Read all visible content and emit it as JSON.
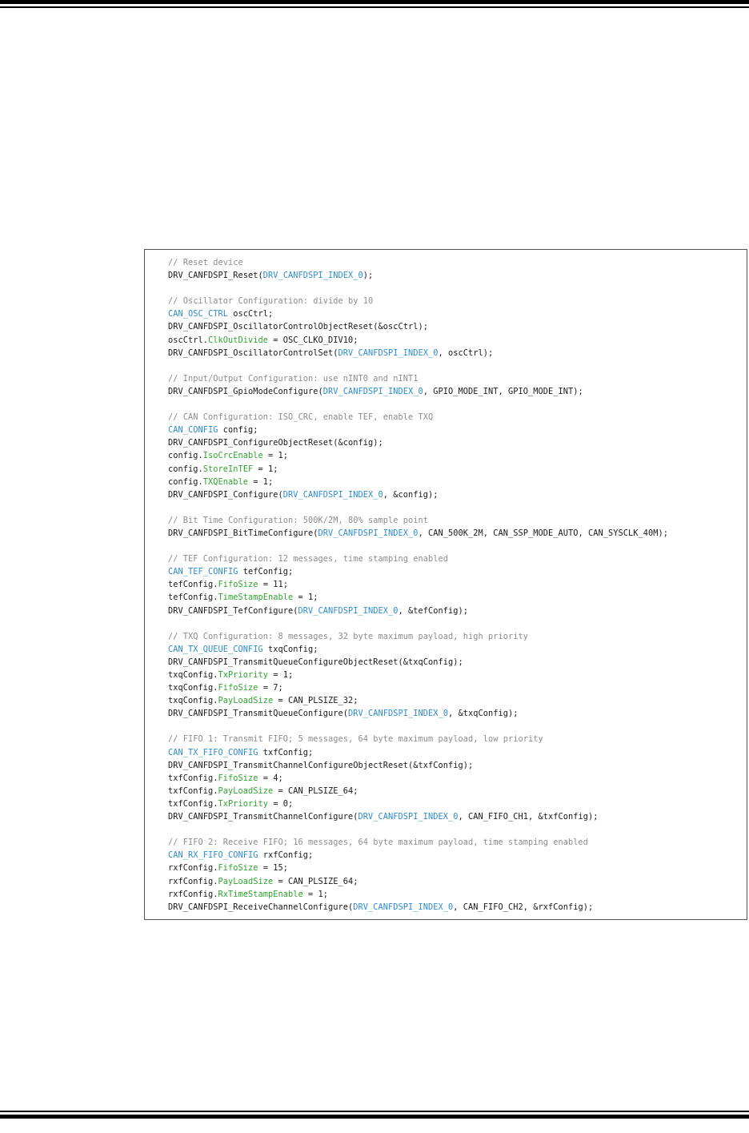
{
  "colors": {
    "plain": "#1a1a1a",
    "comment": "#8c8c8c",
    "type": "#2e8ccf",
    "field": "#2fa52f"
  },
  "code_lines": [
    [
      [
        "c",
        "// Reset device"
      ]
    ],
    [
      [
        "p",
        "DRV_CANFDSPI_Reset("
      ],
      [
        "t",
        "DRV_CANFDSPI_INDEX_0"
      ],
      [
        "p",
        ");"
      ]
    ],
    [],
    [
      [
        "c",
        "// Oscillator Configuration: divide by 10"
      ]
    ],
    [
      [
        "t",
        "CAN_OSC_CTRL"
      ],
      [
        "p",
        " oscCtrl;"
      ]
    ],
    [
      [
        "p",
        "DRV_CANFDSPI_OscillatorControlObjectReset(&oscCtrl);"
      ]
    ],
    [
      [
        "p",
        "oscCtrl."
      ],
      [
        "f",
        "ClkOutDivide"
      ],
      [
        "p",
        " = OSC_CLKO_DIV10;"
      ]
    ],
    [
      [
        "p",
        "DRV_CANFDSPI_OscillatorControlSet("
      ],
      [
        "t",
        "DRV_CANFDSPI_INDEX_0"
      ],
      [
        "p",
        ", oscCtrl);"
      ]
    ],
    [],
    [
      [
        "c",
        "// Input/Output Configuration: use nINT0 and nINT1"
      ]
    ],
    [
      [
        "p",
        "DRV_CANFDSPI_GpioModeConfigure("
      ],
      [
        "t",
        "DRV_CANFDSPI_INDEX_0"
      ],
      [
        "p",
        ", GPIO_MODE_INT, GPIO_MODE_INT);"
      ]
    ],
    [],
    [
      [
        "c",
        "// CAN Configuration: ISO_CRC, enable TEF, enable TXQ"
      ]
    ],
    [
      [
        "t",
        "CAN_CONFIG"
      ],
      [
        "p",
        " config;"
      ]
    ],
    [
      [
        "p",
        "DRV_CANFDSPI_ConfigureObjectReset(&config);"
      ]
    ],
    [
      [
        "p",
        "config."
      ],
      [
        "f",
        "IsoCrcEnable"
      ],
      [
        "p",
        " = 1;"
      ]
    ],
    [
      [
        "p",
        "config."
      ],
      [
        "f",
        "StoreInTEF"
      ],
      [
        "p",
        " = 1;"
      ]
    ],
    [
      [
        "p",
        "config."
      ],
      [
        "f",
        "TXQEnable"
      ],
      [
        "p",
        " = 1;"
      ]
    ],
    [
      [
        "p",
        "DRV_CANFDSPI_Configure("
      ],
      [
        "t",
        "DRV_CANFDSPI_INDEX_0"
      ],
      [
        "p",
        ", &config);"
      ]
    ],
    [],
    [
      [
        "c",
        "// Bit Time Configuration: 500K/2M, 80% sample point"
      ]
    ],
    [
      [
        "p",
        "DRV_CANFDSPI_BitTimeConfigure("
      ],
      [
        "t",
        "DRV_CANFDSPI_INDEX_0"
      ],
      [
        "p",
        ", CAN_500K_2M, CAN_SSP_MODE_AUTO, CAN_SYSCLK_40M);"
      ]
    ],
    [],
    [
      [
        "c",
        "// TEF Configuration: 12 messages, time stamping enabled"
      ]
    ],
    [
      [
        "t",
        "CAN_TEF_CONFIG"
      ],
      [
        "p",
        " tefConfig;"
      ]
    ],
    [
      [
        "p",
        "tefConfig."
      ],
      [
        "f",
        "FifoSize"
      ],
      [
        "p",
        " = 11;"
      ]
    ],
    [
      [
        "p",
        "tefConfig."
      ],
      [
        "f",
        "TimeStampEnable"
      ],
      [
        "p",
        " = 1;"
      ]
    ],
    [
      [
        "p",
        "DRV_CANFDSPI_TefConfigure("
      ],
      [
        "t",
        "DRV_CANFDSPI_INDEX_0"
      ],
      [
        "p",
        ", &tefConfig);"
      ]
    ],
    [],
    [
      [
        "c",
        "// TXQ Configuration: 8 messages, 32 byte maximum payload, high priority"
      ]
    ],
    [
      [
        "t",
        "CAN_TX_QUEUE_CONFIG"
      ],
      [
        "p",
        " txqConfig;"
      ]
    ],
    [
      [
        "p",
        "DRV_CANFDSPI_TransmitQueueConfigureObjectReset(&txqConfig);"
      ]
    ],
    [
      [
        "p",
        "txqConfig."
      ],
      [
        "f",
        "TxPriority"
      ],
      [
        "p",
        " = 1;"
      ]
    ],
    [
      [
        "p",
        "txqConfig."
      ],
      [
        "f",
        "FifoSize"
      ],
      [
        "p",
        " = 7;"
      ]
    ],
    [
      [
        "p",
        "txqConfig."
      ],
      [
        "f",
        "PayLoadSize"
      ],
      [
        "p",
        " = CAN_PLSIZE_32;"
      ]
    ],
    [
      [
        "p",
        "DRV_CANFDSPI_TransmitQueueConfigure("
      ],
      [
        "t",
        "DRV_CANFDSPI_INDEX_0"
      ],
      [
        "p",
        ", &txqConfig);"
      ]
    ],
    [],
    [
      [
        "c",
        "// FIFO 1: Transmit FIFO; 5 messages, 64 byte maximum payload, low priority"
      ]
    ],
    [
      [
        "t",
        "CAN_TX_FIFO_CONFIG"
      ],
      [
        "p",
        " txfConfig;"
      ]
    ],
    [
      [
        "p",
        "DRV_CANFDSPI_TransmitChannelConfigureObjectReset(&txfConfig);"
      ]
    ],
    [
      [
        "p",
        "txfConfig."
      ],
      [
        "f",
        "FifoSize"
      ],
      [
        "p",
        " = 4;"
      ]
    ],
    [
      [
        "p",
        "txfConfig."
      ],
      [
        "f",
        "PayLoadSize"
      ],
      [
        "p",
        " = CAN_PLSIZE_64;"
      ]
    ],
    [
      [
        "p",
        "txfConfig."
      ],
      [
        "f",
        "TxPriority"
      ],
      [
        "p",
        " = 0;"
      ]
    ],
    [
      [
        "p",
        "DRV_CANFDSPI_TransmitChannelConfigure("
      ],
      [
        "t",
        "DRV_CANFDSPI_INDEX_0"
      ],
      [
        "p",
        ", CAN_FIFO_CH1, &txfConfig);"
      ]
    ],
    [],
    [
      [
        "c",
        "// FIFO 2: Receive FIFO; 16 messages, 64 byte maximum payload, time stamping enabled"
      ]
    ],
    [
      [
        "t",
        "CAN_RX_FIFO_CONFIG"
      ],
      [
        "p",
        " rxfConfig;"
      ]
    ],
    [
      [
        "p",
        "rxfConfig."
      ],
      [
        "f",
        "FifoSize"
      ],
      [
        "p",
        " = 15;"
      ]
    ],
    [
      [
        "p",
        "rxfConfig."
      ],
      [
        "f",
        "PayLoadSize"
      ],
      [
        "p",
        " = CAN_PLSIZE_64;"
      ]
    ],
    [
      [
        "p",
        "rxfConfig."
      ],
      [
        "f",
        "RxTimeStampEnable"
      ],
      [
        "p",
        " = 1;"
      ]
    ],
    [
      [
        "p",
        "DRV_CANFDSPI_ReceiveChannelConfigure("
      ],
      [
        "t",
        "DRV_CANFDSPI_INDEX_0"
      ],
      [
        "p",
        ", CAN_FIFO_CH2, &rxfConfig);"
      ]
    ]
  ]
}
